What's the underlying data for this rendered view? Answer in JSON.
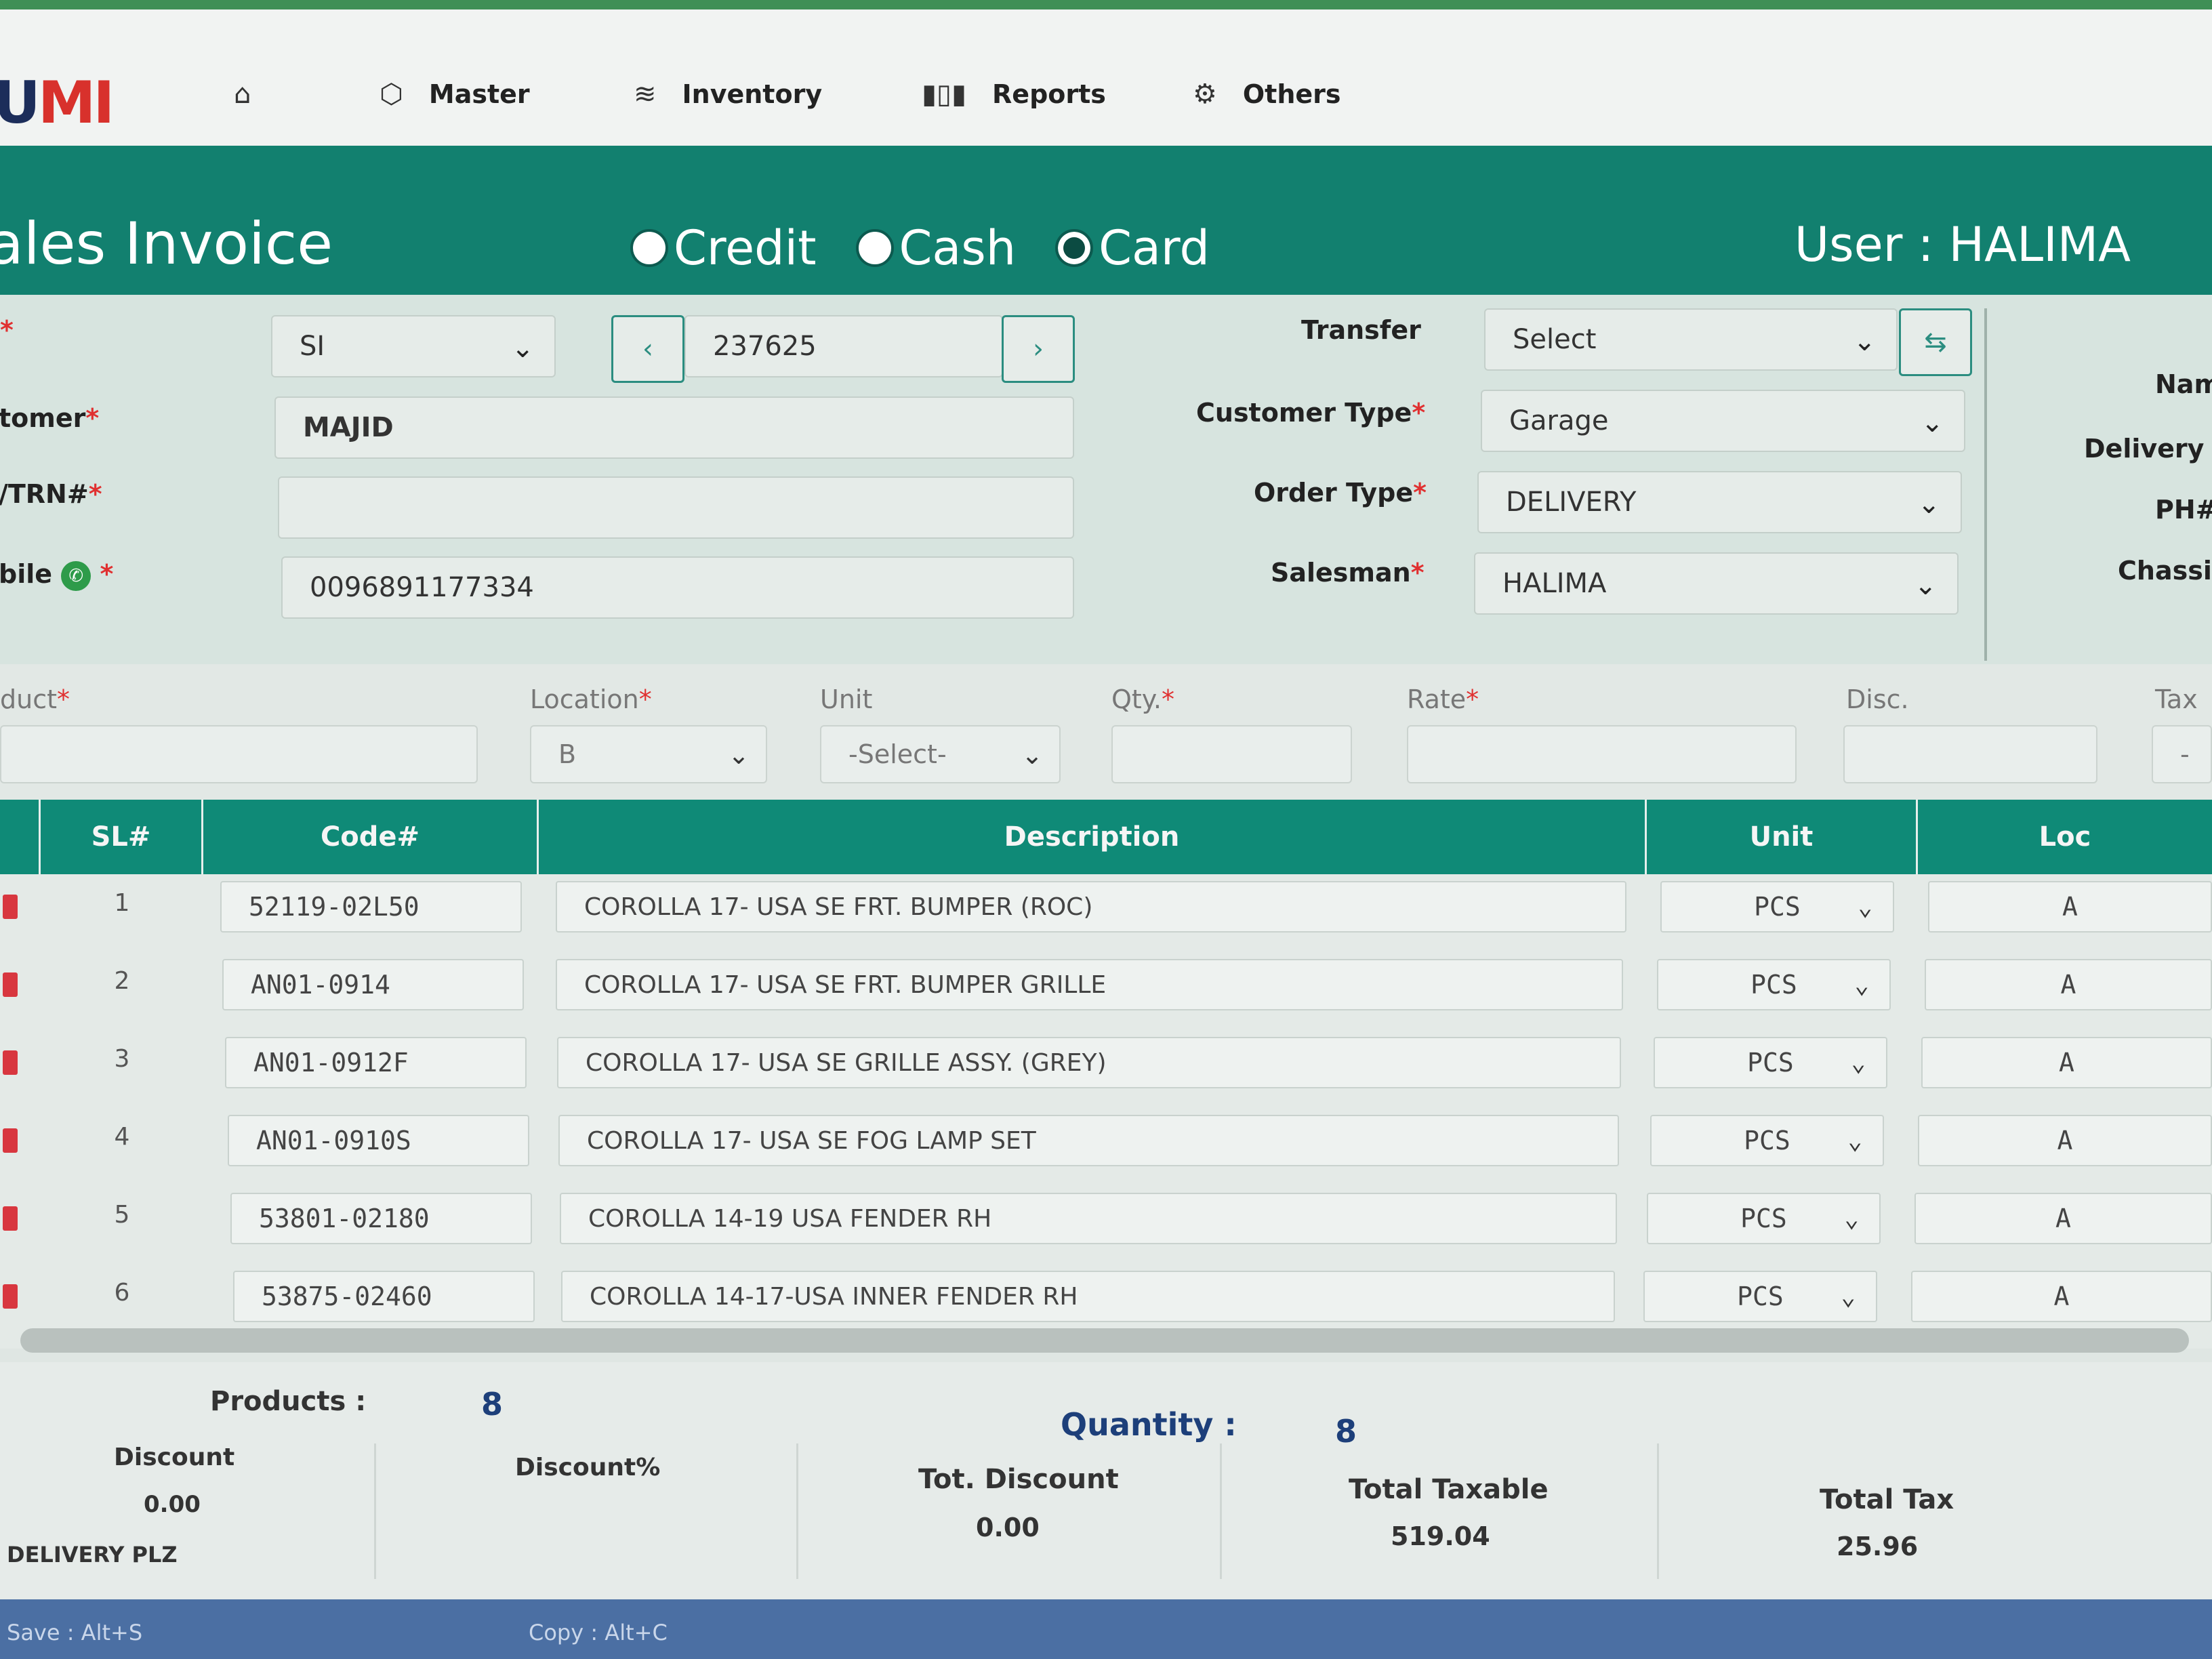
{
  "nav": {
    "logo_dark": "U",
    "logo_red": "MI",
    "items": [
      {
        "label": "",
        "icon": "home-icon"
      },
      {
        "label": "Master",
        "icon": "cube-icon"
      },
      {
        "label": "Inventory",
        "icon": "layers-icon"
      },
      {
        "label": "Reports",
        "icon": "bar-chart-icon"
      },
      {
        "label": "Others",
        "icon": "settings-icon"
      }
    ]
  },
  "banner": {
    "title": "ales Invoice",
    "payment_options": [
      "Credit",
      "Cash",
      "Card"
    ],
    "payment_selected": "Card",
    "user": "User : HALIMA"
  },
  "form": {
    "doc_type": "SI",
    "invoice_no": "237625",
    "customer_label": "tomer",
    "customer": "MAJID",
    "trn_label": "/TRN#",
    "trn": "",
    "mobile_label": "bile",
    "mobile": "0096891177334",
    "transfer_label": "Transfer",
    "transfer": "Select",
    "customer_type_label": "Customer Type",
    "customer_type": "Garage",
    "order_type_label": "Order Type",
    "order_type": "DELIVERY",
    "salesman_label": "Salesman",
    "salesman": "HALIMA",
    "right_labels": [
      "Nam",
      "Delivery",
      "PH#",
      "Chassi"
    ]
  },
  "entry": {
    "product_label": "duct",
    "location_label": "Location",
    "location": "B",
    "unit_label": "Unit",
    "unit": "-Select-",
    "qty_label": "Qty.",
    "rate_label": "Rate",
    "disc_label": "Disc.",
    "tax_label": "Tax",
    "tax_value": "-"
  },
  "table": {
    "headers": [
      "SL#",
      "Code#",
      "Description",
      "Unit",
      "Loc"
    ],
    "rows": [
      {
        "sl": "1",
        "code": "52119-02L50",
        "desc": "COROLLA 17- USA SE FRT. BUMPER (ROC)",
        "unit": "PCS",
        "loc": "A"
      },
      {
        "sl": "2",
        "code": "AN01-0914",
        "desc": "COROLLA 17- USA SE FRT. BUMPER GRILLE",
        "unit": "PCS",
        "loc": "A"
      },
      {
        "sl": "3",
        "code": "AN01-0912F",
        "desc": "COROLLA 17- USA SE GRILLE ASSY. (GREY)",
        "unit": "PCS",
        "loc": "A"
      },
      {
        "sl": "4",
        "code": "AN01-0910S",
        "desc": "COROLLA 17- USA SE FOG LAMP SET",
        "unit": "PCS",
        "loc": "A"
      },
      {
        "sl": "5",
        "code": "53801-02180",
        "desc": "COROLLA 14-19 USA FENDER RH",
        "unit": "PCS",
        "loc": "A"
      },
      {
        "sl": "6",
        "code": "53875-02460",
        "desc": "COROLLA 14-17-USA INNER FENDER RH",
        "unit": "PCS",
        "loc": "A"
      }
    ]
  },
  "summary": {
    "products_label": "Products :",
    "products": "8",
    "quantity_label": "Quantity :",
    "quantity": "8",
    "discount_label": "Discount",
    "discount": "0.00",
    "discount_pct_label": "Discount%",
    "tot_discount_label": "Tot. Discount",
    "tot_discount": "0.00",
    "total_taxable_label": "Total Taxable",
    "total_taxable": "519.04",
    "total_tax_label": "Total Tax",
    "total_tax": "25.96",
    "note": "DELIVERY PLZ"
  },
  "footer": {
    "save": "Save : Alt+S",
    "copy": "Copy : Alt+C"
  },
  "colors": {
    "primary": "#12806f",
    "header": "#0f8a77",
    "logo_red": "#d8312c",
    "logo_dark": "#1c2d5a",
    "footer": "#4b6fa3"
  }
}
